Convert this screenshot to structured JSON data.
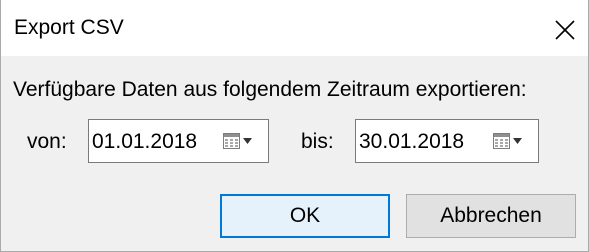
{
  "window": {
    "title": "Export CSV",
    "close_glyph": "close-icon"
  },
  "prompt": "Verfügbare Daten aus folgendem Zeitraum exportieren:",
  "from": {
    "label": "von:",
    "value": "01.01.2018",
    "icon": "calendar-dropdown-icon"
  },
  "to": {
    "label": "bis:",
    "value": "30.01.2018",
    "icon": "calendar-dropdown-icon"
  },
  "buttons": {
    "ok": "OK",
    "cancel": "Abbrechen"
  },
  "colors": {
    "titlebar": "#ffffff",
    "dialog_bg": "#f0f0f0",
    "ok_border": "#0078d7",
    "ok_bg": "#e5f1fb",
    "cancel_bg": "#e1e1e1",
    "field_border": "#7a7a7a"
  }
}
